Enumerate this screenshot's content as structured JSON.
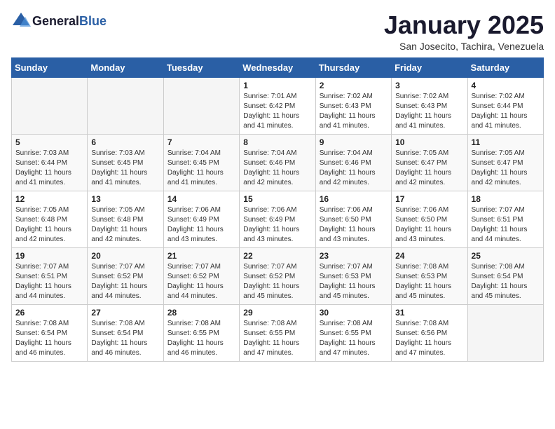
{
  "header": {
    "logo_general": "General",
    "logo_blue": "Blue",
    "month_title": "January 2025",
    "location": "San Josecito, Tachira, Venezuela"
  },
  "days_of_week": [
    "Sunday",
    "Monday",
    "Tuesday",
    "Wednesday",
    "Thursday",
    "Friday",
    "Saturday"
  ],
  "weeks": [
    [
      {
        "day": "",
        "info": ""
      },
      {
        "day": "",
        "info": ""
      },
      {
        "day": "",
        "info": ""
      },
      {
        "day": "1",
        "info": "Sunrise: 7:01 AM\nSunset: 6:42 PM\nDaylight: 11 hours\nand 41 minutes."
      },
      {
        "day": "2",
        "info": "Sunrise: 7:02 AM\nSunset: 6:43 PM\nDaylight: 11 hours\nand 41 minutes."
      },
      {
        "day": "3",
        "info": "Sunrise: 7:02 AM\nSunset: 6:43 PM\nDaylight: 11 hours\nand 41 minutes."
      },
      {
        "day": "4",
        "info": "Sunrise: 7:02 AM\nSunset: 6:44 PM\nDaylight: 11 hours\nand 41 minutes."
      }
    ],
    [
      {
        "day": "5",
        "info": "Sunrise: 7:03 AM\nSunset: 6:44 PM\nDaylight: 11 hours\nand 41 minutes."
      },
      {
        "day": "6",
        "info": "Sunrise: 7:03 AM\nSunset: 6:45 PM\nDaylight: 11 hours\nand 41 minutes."
      },
      {
        "day": "7",
        "info": "Sunrise: 7:04 AM\nSunset: 6:45 PM\nDaylight: 11 hours\nand 41 minutes."
      },
      {
        "day": "8",
        "info": "Sunrise: 7:04 AM\nSunset: 6:46 PM\nDaylight: 11 hours\nand 42 minutes."
      },
      {
        "day": "9",
        "info": "Sunrise: 7:04 AM\nSunset: 6:46 PM\nDaylight: 11 hours\nand 42 minutes."
      },
      {
        "day": "10",
        "info": "Sunrise: 7:05 AM\nSunset: 6:47 PM\nDaylight: 11 hours\nand 42 minutes."
      },
      {
        "day": "11",
        "info": "Sunrise: 7:05 AM\nSunset: 6:47 PM\nDaylight: 11 hours\nand 42 minutes."
      }
    ],
    [
      {
        "day": "12",
        "info": "Sunrise: 7:05 AM\nSunset: 6:48 PM\nDaylight: 11 hours\nand 42 minutes."
      },
      {
        "day": "13",
        "info": "Sunrise: 7:05 AM\nSunset: 6:48 PM\nDaylight: 11 hours\nand 42 minutes."
      },
      {
        "day": "14",
        "info": "Sunrise: 7:06 AM\nSunset: 6:49 PM\nDaylight: 11 hours\nand 43 minutes."
      },
      {
        "day": "15",
        "info": "Sunrise: 7:06 AM\nSunset: 6:49 PM\nDaylight: 11 hours\nand 43 minutes."
      },
      {
        "day": "16",
        "info": "Sunrise: 7:06 AM\nSunset: 6:50 PM\nDaylight: 11 hours\nand 43 minutes."
      },
      {
        "day": "17",
        "info": "Sunrise: 7:06 AM\nSunset: 6:50 PM\nDaylight: 11 hours\nand 43 minutes."
      },
      {
        "day": "18",
        "info": "Sunrise: 7:07 AM\nSunset: 6:51 PM\nDaylight: 11 hours\nand 44 minutes."
      }
    ],
    [
      {
        "day": "19",
        "info": "Sunrise: 7:07 AM\nSunset: 6:51 PM\nDaylight: 11 hours\nand 44 minutes."
      },
      {
        "day": "20",
        "info": "Sunrise: 7:07 AM\nSunset: 6:52 PM\nDaylight: 11 hours\nand 44 minutes."
      },
      {
        "day": "21",
        "info": "Sunrise: 7:07 AM\nSunset: 6:52 PM\nDaylight: 11 hours\nand 44 minutes."
      },
      {
        "day": "22",
        "info": "Sunrise: 7:07 AM\nSunset: 6:52 PM\nDaylight: 11 hours\nand 45 minutes."
      },
      {
        "day": "23",
        "info": "Sunrise: 7:07 AM\nSunset: 6:53 PM\nDaylight: 11 hours\nand 45 minutes."
      },
      {
        "day": "24",
        "info": "Sunrise: 7:08 AM\nSunset: 6:53 PM\nDaylight: 11 hours\nand 45 minutes."
      },
      {
        "day": "25",
        "info": "Sunrise: 7:08 AM\nSunset: 6:54 PM\nDaylight: 11 hours\nand 45 minutes."
      }
    ],
    [
      {
        "day": "26",
        "info": "Sunrise: 7:08 AM\nSunset: 6:54 PM\nDaylight: 11 hours\nand 46 minutes."
      },
      {
        "day": "27",
        "info": "Sunrise: 7:08 AM\nSunset: 6:54 PM\nDaylight: 11 hours\nand 46 minutes."
      },
      {
        "day": "28",
        "info": "Sunrise: 7:08 AM\nSunset: 6:55 PM\nDaylight: 11 hours\nand 46 minutes."
      },
      {
        "day": "29",
        "info": "Sunrise: 7:08 AM\nSunset: 6:55 PM\nDaylight: 11 hours\nand 47 minutes."
      },
      {
        "day": "30",
        "info": "Sunrise: 7:08 AM\nSunset: 6:55 PM\nDaylight: 11 hours\nand 47 minutes."
      },
      {
        "day": "31",
        "info": "Sunrise: 7:08 AM\nSunset: 6:56 PM\nDaylight: 11 hours\nand 47 minutes."
      },
      {
        "day": "",
        "info": ""
      }
    ]
  ]
}
